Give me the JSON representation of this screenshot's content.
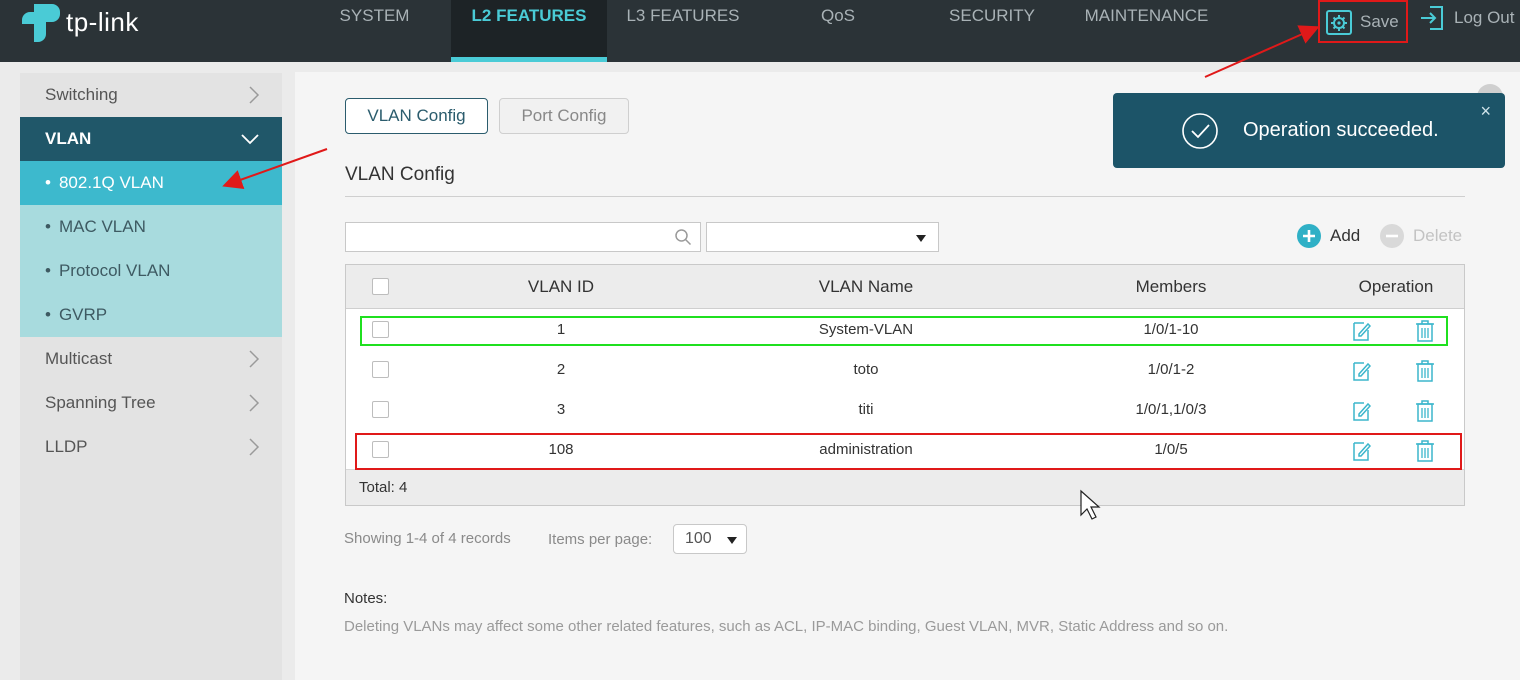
{
  "header": {
    "brand": "tp-link",
    "nav": [
      {
        "label": "SYSTEM"
      },
      {
        "label": "L2 FEATURES",
        "active": true
      },
      {
        "label": "L3 FEATURES"
      },
      {
        "label": "QoS"
      },
      {
        "label": "SECURITY"
      },
      {
        "label": "MAINTENANCE"
      }
    ],
    "save_label": "Save",
    "logout_label": "Log Out"
  },
  "sidebar": {
    "items": [
      {
        "label": "Switching",
        "icon": "chevron-right-icon"
      },
      {
        "label": "VLAN",
        "icon": "chevron-down-icon",
        "expanded": true
      },
      {
        "label": "Multicast",
        "icon": "chevron-right-icon"
      },
      {
        "label": "Spanning Tree",
        "icon": "chevron-right-icon"
      },
      {
        "label": "LLDP",
        "icon": "chevron-right-icon"
      }
    ],
    "vlan_sub": [
      {
        "label": "802.1Q VLAN",
        "active": true
      },
      {
        "label": "MAC VLAN"
      },
      {
        "label": "Protocol VLAN"
      },
      {
        "label": "GVRP"
      }
    ],
    "bullet": "•"
  },
  "tabs": [
    {
      "label": "VLAN Config",
      "active": true
    },
    {
      "label": "Port Config"
    }
  ],
  "section_title": "VLAN Config",
  "toolbar": {
    "search_value": "",
    "filter_value": "",
    "add_label": "Add",
    "delete_label": "Delete"
  },
  "table": {
    "columns": [
      "VLAN ID",
      "VLAN Name",
      "Members",
      "Operation"
    ],
    "rows": [
      {
        "id": "1",
        "name": "System-VLAN",
        "members": "1/0/1-10"
      },
      {
        "id": "2",
        "name": "toto",
        "members": "1/0/1-2"
      },
      {
        "id": "3",
        "name": "titi",
        "members": "1/0/1,1/0/3"
      },
      {
        "id": "108",
        "name": "administration",
        "members": "1/0/5"
      }
    ],
    "total": "Total: 4"
  },
  "pagination": {
    "showing": "Showing 1-4 of 4 records",
    "items_per_page_label": "Items per page:",
    "items_per_page_value": "100"
  },
  "notes": {
    "title": "Notes:",
    "text": "Deleting VLANs may affect some other related features, such as ACL, IP-MAC binding, Guest VLAN, MVR, Static Address and so on."
  },
  "toast": {
    "message": "Operation succeeded.",
    "close": "×"
  },
  "colors": {
    "topbar": "#2b3337",
    "accent": "#4acbd6",
    "vlan_header": "#205769",
    "submenu": "#a8dbde",
    "submenu_active": "#3db9cd",
    "toast": "#1c5468",
    "annotation_red": "#e01919",
    "annotation_green": "#1fe01f"
  }
}
